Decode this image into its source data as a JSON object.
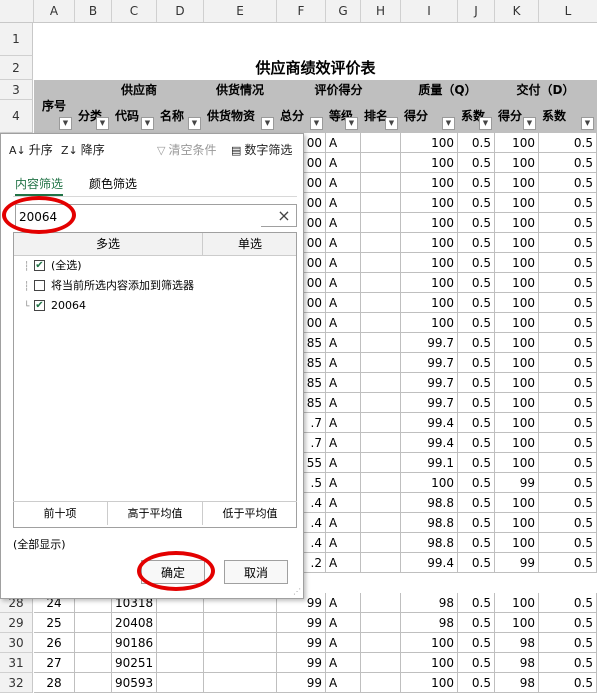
{
  "sheet": {
    "columns": [
      "A",
      "B",
      "C",
      "D",
      "E",
      "F",
      "G",
      "H",
      "I",
      "J",
      "K",
      "L"
    ],
    "title": "供应商绩效评价表",
    "row_labels": [
      "1",
      "2",
      "3",
      "4"
    ],
    "header_row3": {
      "seq": "序号",
      "supplier": "供应商",
      "supply": "供货情况",
      "score": "评价得分",
      "quality": "质量（Q）",
      "delivery": "交付（D）"
    },
    "header_row4": [
      "分类",
      "代码",
      "名称",
      "供货物资",
      "总分",
      "等级",
      "排名",
      "得分",
      "系数",
      "得分",
      "系数"
    ],
    "body_rows": [
      {
        "q": "100",
        "qc": "0.5",
        "d": "100",
        "dc": "0.5",
        "f": "00",
        "g": "A"
      },
      {
        "q": "100",
        "qc": "0.5",
        "d": "100",
        "dc": "0.5",
        "f": "00",
        "g": "A"
      },
      {
        "q": "100",
        "qc": "0.5",
        "d": "100",
        "dc": "0.5",
        "f": "00",
        "g": "A"
      },
      {
        "q": "100",
        "qc": "0.5",
        "d": "100",
        "dc": "0.5",
        "f": "00",
        "g": "A"
      },
      {
        "q": "100",
        "qc": "0.5",
        "d": "100",
        "dc": "0.5",
        "f": "00",
        "g": "A"
      },
      {
        "q": "100",
        "qc": "0.5",
        "d": "100",
        "dc": "0.5",
        "f": "00",
        "g": "A"
      },
      {
        "q": "100",
        "qc": "0.5",
        "d": "100",
        "dc": "0.5",
        "f": "00",
        "g": "A"
      },
      {
        "q": "100",
        "qc": "0.5",
        "d": "100",
        "dc": "0.5",
        "f": "00",
        "g": "A"
      },
      {
        "q": "100",
        "qc": "0.5",
        "d": "100",
        "dc": "0.5",
        "f": "00",
        "g": "A"
      },
      {
        "q": "100",
        "qc": "0.5",
        "d": "100",
        "dc": "0.5",
        "f": "00",
        "g": "A"
      },
      {
        "q": "99.7",
        "qc": "0.5",
        "d": "100",
        "dc": "0.5",
        "f": "85",
        "g": "A"
      },
      {
        "q": "99.7",
        "qc": "0.5",
        "d": "100",
        "dc": "0.5",
        "f": "85",
        "g": "A"
      },
      {
        "q": "99.7",
        "qc": "0.5",
        "d": "100",
        "dc": "0.5",
        "f": "85",
        "g": "A"
      },
      {
        "q": "99.7",
        "qc": "0.5",
        "d": "100",
        "dc": "0.5",
        "f": "85",
        "g": "A"
      },
      {
        "q": "99.4",
        "qc": "0.5",
        "d": "100",
        "dc": "0.5",
        "f": ".7",
        "g": "A"
      },
      {
        "q": "99.4",
        "qc": "0.5",
        "d": "100",
        "dc": "0.5",
        "f": ".7",
        "g": "A"
      },
      {
        "q": "99.1",
        "qc": "0.5",
        "d": "100",
        "dc": "0.5",
        "f": "55",
        "g": "A"
      },
      {
        "q": "100",
        "qc": "0.5",
        "d": "99",
        "dc": "0.5",
        "f": ".5",
        "g": "A"
      },
      {
        "q": "98.8",
        "qc": "0.5",
        "d": "100",
        "dc": "0.5",
        "f": ".4",
        "g": "A"
      },
      {
        "q": "98.8",
        "qc": "0.5",
        "d": "100",
        "dc": "0.5",
        "f": ".4",
        "g": "A"
      },
      {
        "q": "98.8",
        "qc": "0.5",
        "d": "100",
        "dc": "0.5",
        "f": ".4",
        "g": "A"
      },
      {
        "q": "99.4",
        "qc": "0.5",
        "d": "99",
        "dc": "0.5",
        "f": ".2",
        "g": "A"
      }
    ],
    "lower_rows": [
      {
        "row": "28",
        "seq": "24",
        "code": "10318",
        "f": "99",
        "g": "A",
        "q": "98",
        "qc": "0.5",
        "d": "100",
        "dc": "0.5"
      },
      {
        "row": "29",
        "seq": "25",
        "code": "20408",
        "f": "99",
        "g": "A",
        "q": "98",
        "qc": "0.5",
        "d": "100",
        "dc": "0.5"
      },
      {
        "row": "30",
        "seq": "26",
        "code": "90186",
        "f": "99",
        "g": "A",
        "q": "100",
        "qc": "0.5",
        "d": "98",
        "dc": "0.5"
      },
      {
        "row": "31",
        "seq": "27",
        "code": "90251",
        "f": "99",
        "g": "A",
        "q": "100",
        "qc": "0.5",
        "d": "98",
        "dc": "0.5"
      },
      {
        "row": "32",
        "seq": "28",
        "code": "90593",
        "f": "99",
        "g": "A",
        "q": "100",
        "qc": "0.5",
        "d": "98",
        "dc": "0.5"
      }
    ]
  },
  "filter_popup": {
    "sort_asc": "升序",
    "sort_desc": "降序",
    "clear_condition": "清空条件",
    "number_filter": "数字筛选",
    "tab_content": "内容筛选",
    "tab_color": "颜色筛选",
    "search_value": "20064",
    "list_header_multi": "多选",
    "list_header_single": "单选",
    "items": [
      "(全选)",
      "将当前所选内容添加到筛选器",
      "20064"
    ],
    "items_checked": [
      true,
      false,
      true
    ],
    "top10": "前十项",
    "above_avg": "高于平均值",
    "below_avg": "低于平均值",
    "show_all": "(全部显示)",
    "ok": "确定",
    "cancel": "取消"
  },
  "colors": {
    "header_fill": "#bfbfbf",
    "accent": "#217346",
    "highlight_ring": "#e30000"
  }
}
